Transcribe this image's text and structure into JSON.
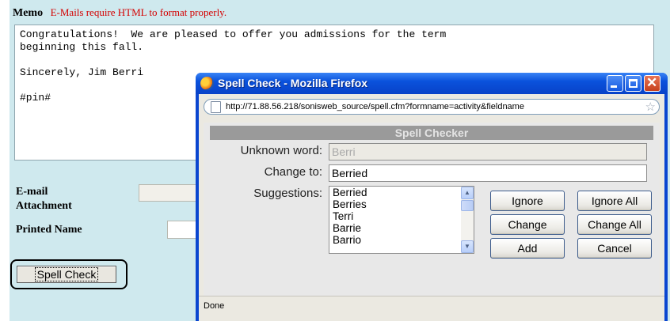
{
  "memo": {
    "label": "Memo",
    "note": "E-Mails require HTML to format properly.",
    "body": "Congratulations!  We are pleased to offer you admissions for the term\nbeginning this fall.\n\nSincerely, Jim Berri\n\n#pin#"
  },
  "form": {
    "email_attachment_line1": "E-mail",
    "email_attachment_line2": "Attachment",
    "printed_name": "Printed Name",
    "spell_check_button": "Spell Check"
  },
  "window": {
    "title": "Spell Check - Mozilla Firefox",
    "url": "http://71.88.56.218/sonisweb_source/spell.cfm?formname=activity&fieldname",
    "status": "Done"
  },
  "spell_checker": {
    "header": "Spell Checker",
    "unknown_word_label": "Unknown word:",
    "unknown_word_value": "Berri",
    "change_to_label": "Change to:",
    "change_to_value": "Berried",
    "suggestions_label": "Suggestions:",
    "suggestions": [
      "Berried",
      "Berries",
      "Terri",
      "Barrie",
      "Barrio"
    ],
    "buttons": {
      "ignore": "Ignore",
      "ignore_all": "Ignore All",
      "change": "Change",
      "change_all": "Change All",
      "add": "Add",
      "cancel": "Cancel"
    }
  }
}
